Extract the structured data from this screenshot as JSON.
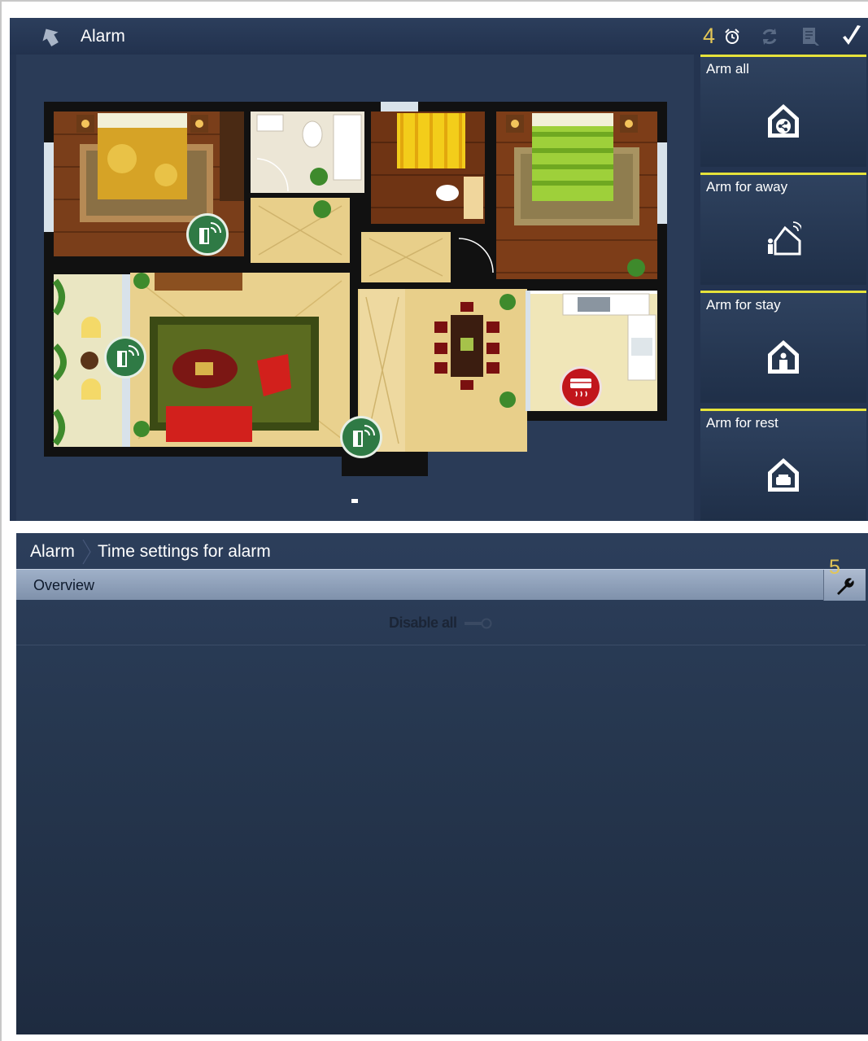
{
  "top_panel": {
    "title": "Alarm",
    "header_number": "4",
    "header_icons": [
      "back-arrow-icon",
      "alarm-clock-icon",
      "refresh-icon",
      "notes-icon",
      "checkmark-icon"
    ],
    "modes": [
      {
        "label": "Arm all",
        "icon": "arm-all-house-icon"
      },
      {
        "label": "Arm for away",
        "icon": "arm-away-house-icon"
      },
      {
        "label": "Arm for stay",
        "icon": "arm-stay-house-icon"
      },
      {
        "label": "Arm for rest",
        "icon": "arm-rest-house-icon"
      }
    ],
    "sensor_markers": [
      "door-sensor-icon",
      "door-sensor-icon",
      "door-sensor-icon",
      "heating-alarm-icon"
    ]
  },
  "bottom_panel": {
    "breadcrumb": {
      "root": "Alarm",
      "current": "Time settings for alarm"
    },
    "header_number": "5",
    "overview_label": "Overview",
    "disable_label": "Disable all",
    "disable_toggle_on": false
  },
  "colors": {
    "panel_bg": "#243450",
    "accent_yellow": "#e6e33a",
    "annotation_number": "#e3c656",
    "overview_bar": "#8fa1bb"
  }
}
